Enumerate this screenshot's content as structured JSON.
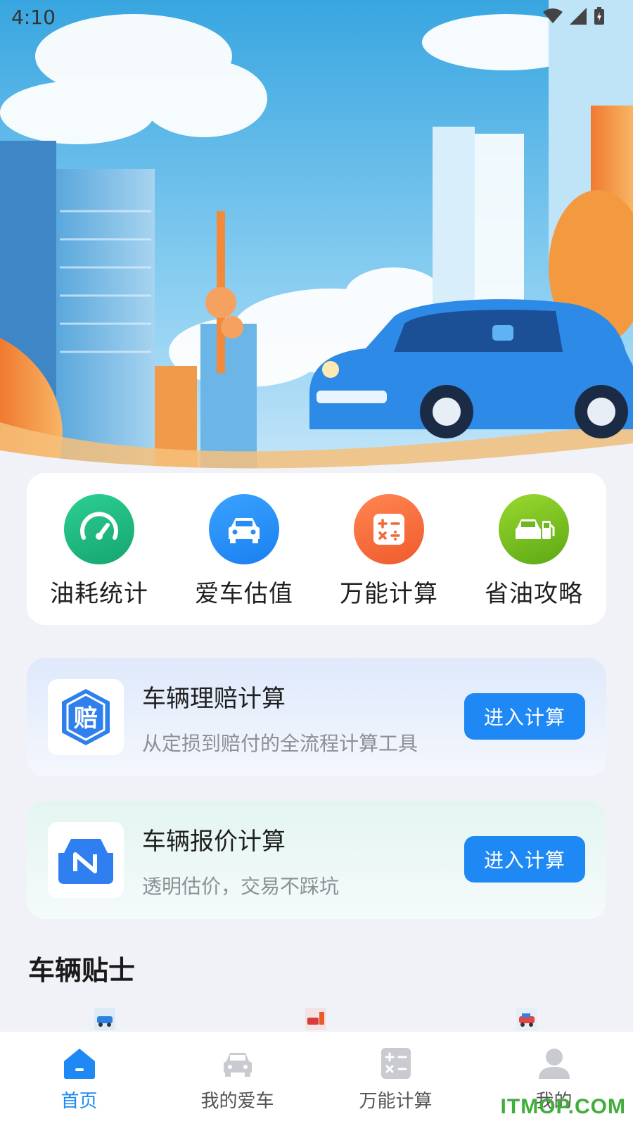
{
  "status_bar": {
    "time": "4:10"
  },
  "quick_actions": [
    {
      "label": "油耗统计",
      "icon": "speedometer-icon",
      "color": "#1eb57f"
    },
    {
      "label": "爱车估值",
      "icon": "car-front-icon",
      "color": "#1e8cf5"
    },
    {
      "label": "万能计算",
      "icon": "calculator-icon",
      "color": "#f56a3a"
    },
    {
      "label": "省油攻略",
      "icon": "fuel-car-icon",
      "color": "#79c11d"
    }
  ],
  "calc_cards": [
    {
      "title": "车辆理赔计算",
      "subtitle": "从定损到赔付的全流程计算工具",
      "button": "进入计算",
      "icon_char": "赔"
    },
    {
      "title": "车辆报价计算",
      "subtitle": "透明估价，交易不踩坑",
      "button": "进入计算"
    }
  ],
  "tips": {
    "title": "车辆贴士"
  },
  "bottom_nav": [
    {
      "label": "首页",
      "active": true
    },
    {
      "label": "我的爱车",
      "active": false
    },
    {
      "label": "万能计算",
      "active": false
    },
    {
      "label": "我的",
      "active": false
    }
  ],
  "watermark": "ITMOP.COM",
  "colors": {
    "accent": "#1e88f5",
    "background": "#f1f2f7"
  }
}
